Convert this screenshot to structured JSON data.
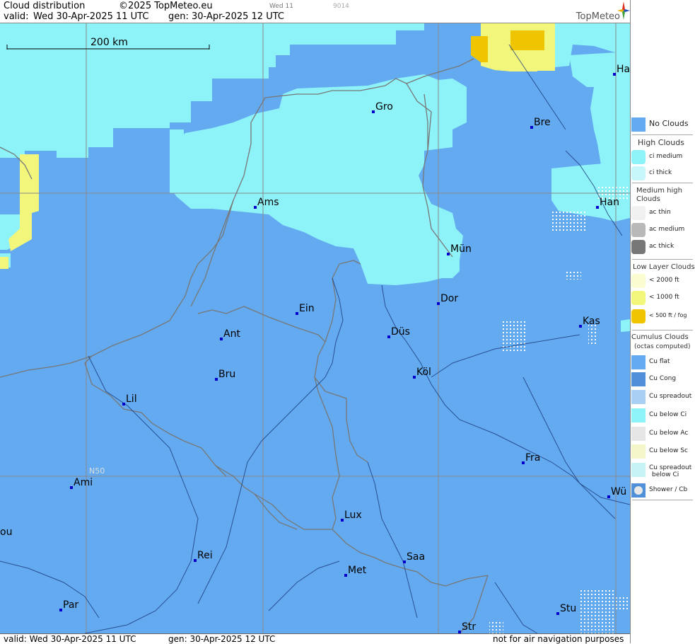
{
  "header": {
    "title": "Cloud distribution",
    "copyright": "©2025 TopMeteo.eu",
    "day_label": "Wed 11",
    "code": "9014",
    "valid_prefix": "valid:",
    "valid_time": "Wed  30-Apr-2025  11 UTC",
    "gen_time": "gen: 30-Apr-2025 12 UTC",
    "logo": "TopMeteo"
  },
  "map": {
    "scale_label": "200 km",
    "lat_label": "N50",
    "colors": {
      "no_clouds": "#63aaf0",
      "ci_medium": "#8ef3f8",
      "low_1000": "#f2f77c",
      "low_500": "#efc400",
      "border": "#777777",
      "river": "#1a3a7a",
      "grid": "#888888",
      "city_dot": "#0000cc"
    },
    "cities": [
      {
        "name": "Gro"
      },
      {
        "name": "Bre"
      },
      {
        "name": "Ha"
      },
      {
        "name": "Ams"
      },
      {
        "name": "Han"
      },
      {
        "name": "Mün"
      },
      {
        "name": "Ein"
      },
      {
        "name": "Dor"
      },
      {
        "name": "Kas"
      },
      {
        "name": "Ant"
      },
      {
        "name": "Düs"
      },
      {
        "name": "Bru"
      },
      {
        "name": "Köl"
      },
      {
        "name": "Lil"
      },
      {
        "name": "Fra"
      },
      {
        "name": "Ami"
      },
      {
        "name": "Wü"
      },
      {
        "name": "Lux"
      },
      {
        "name": "ou"
      },
      {
        "name": "Rei"
      },
      {
        "name": "Saa"
      },
      {
        "name": "Met"
      },
      {
        "name": "Par"
      },
      {
        "name": "Stu"
      },
      {
        "name": "Str"
      }
    ]
  },
  "footer": {
    "valid": "valid:  Wed  30-Apr-2025  11 UTC",
    "gen": "gen: 30-Apr-2025 12 UTC",
    "disclaimer": "not for air navigation purposes"
  },
  "legend": {
    "no_clouds": "No Clouds",
    "high_title": "High Clouds",
    "ci_medium": "ci medium",
    "ci_thick": "ci thick",
    "medium_title": "Medium high Clouds",
    "ac_thin": "ac thin",
    "ac_medium": "ac medium",
    "ac_thick": "ac thick",
    "low_title": "Low Layer Clouds",
    "low_2000": "< 2000 ft",
    "low_1000": "< 1000 ft",
    "low_500": "< 500 ft / fog",
    "cu_title": "Cumulus Clouds",
    "cu_sub": "(octas computed)",
    "cu_flat": "Cu flat",
    "cu_cong": "Cu Cong",
    "cu_spreadout": "Cu spreadout",
    "cu_below_ci": "Cu below Ci",
    "cu_below_ac": "Cu below Ac",
    "cu_below_sc": "Cu below Sc",
    "cu_spread_ci_1": "Cu spreadout",
    "cu_spread_ci_2": "below Ci",
    "shower": "Shower / Cb"
  }
}
